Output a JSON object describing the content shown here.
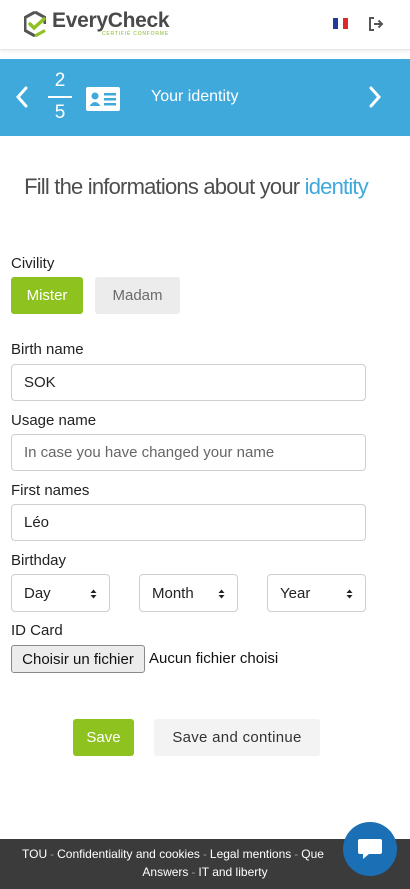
{
  "brand": {
    "name": "EveryCheck",
    "tagline": "CERTIFIÉ CONFORME",
    "accent": "#8dc21f"
  },
  "header": {
    "language_flag": "french-flag-icon",
    "logout_icon": "logout-icon"
  },
  "stepper": {
    "current": "2",
    "total": "5",
    "title": "Your identity",
    "background": "#40a9dc",
    "icon": "id-card-icon"
  },
  "page": {
    "title_main": "Fill the informations about your ",
    "title_accent": "identity"
  },
  "form": {
    "civility": {
      "label": "Civility",
      "options": [
        "Mister",
        "Madam"
      ],
      "selected": "Mister"
    },
    "birth_name": {
      "label": "Birth name",
      "value": "SOK"
    },
    "usage_name": {
      "label": "Usage name",
      "placeholder": "In case you have changed your name"
    },
    "first_names": {
      "label": "First names",
      "value": "Léo"
    },
    "birthday": {
      "label": "Birthday",
      "day": "Day",
      "month": "Month",
      "year": "Year"
    },
    "id_card": {
      "label": "ID Card",
      "button": "Choisir un fichier",
      "status": "Aucun fichier choisi"
    }
  },
  "actions": {
    "save": "Save",
    "save_continue": "Save and continue"
  },
  "footer": {
    "links": [
      "TOU",
      "Confidentiality and cookies",
      "Legal mentions",
      "Questions & Answers",
      "IT and liberty"
    ],
    "line1": [
      "TOU",
      "Confidentiality and cookies",
      "Legal mentions",
      "Que"
    ],
    "line2": [
      "Answers",
      "IT and liberty"
    ],
    "chat_icon": "chat-bubble-icon"
  }
}
